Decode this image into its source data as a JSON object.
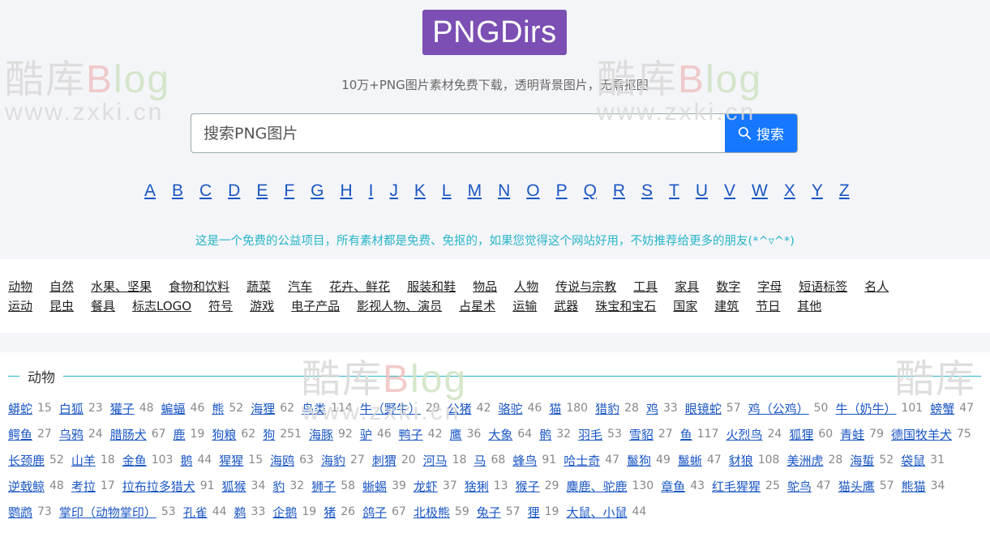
{
  "header": {
    "logo": "PNGDirs",
    "tagline": "10万+PNG图片素材免费下载，透明背景图片，无需抠图"
  },
  "search": {
    "placeholder": "搜索PNG图片",
    "button_label": "搜索"
  },
  "alphabet": [
    "A",
    "B",
    "C",
    "D",
    "E",
    "F",
    "G",
    "H",
    "I",
    "J",
    "K",
    "L",
    "M",
    "N",
    "O",
    "P",
    "Q",
    "R",
    "S",
    "T",
    "U",
    "V",
    "W",
    "X",
    "Y",
    "Z"
  ],
  "notice": "这是一个免费的公益项目，所有素材都是免费、免抠的，如果您觉得这个网站好用，不妨推荐给更多的朋友(*^▿^*)",
  "categories_row1": [
    "动物",
    "自然",
    "水果、坚果",
    "食物和饮料",
    "蔬菜",
    "汽车",
    "花卉、鲜花",
    "服装和鞋",
    "物品",
    "人物",
    "传说与宗教",
    "工具",
    "家具",
    "数字",
    "字母",
    "短语标签",
    "名人"
  ],
  "categories_row2": [
    "运动",
    "昆虫",
    "餐具",
    "标志LOGO",
    "符号",
    "游戏",
    "电子产品",
    "影视人物、演员",
    "占星术",
    "运输",
    "武器",
    "珠宝和宝石",
    "国家",
    "建筑",
    "节日",
    "其他"
  ],
  "section": {
    "title": "动物",
    "items": [
      {
        "name": "蟒蛇",
        "count": "15"
      },
      {
        "name": "白狐",
        "count": "23"
      },
      {
        "name": "獾子",
        "count": "48"
      },
      {
        "name": "蝙蝠",
        "count": "46"
      },
      {
        "name": "熊",
        "count": "52"
      },
      {
        "name": "海狸",
        "count": "62"
      },
      {
        "name": "鸟类",
        "count": "114"
      },
      {
        "name": "牛（野牛）",
        "count": "29"
      },
      {
        "name": "公猪",
        "count": "42"
      },
      {
        "name": "骆驼",
        "count": "46"
      },
      {
        "name": "猫",
        "count": "180"
      },
      {
        "name": "猎豹",
        "count": "28"
      },
      {
        "name": "鸡",
        "count": "33"
      },
      {
        "name": "眼镜蛇",
        "count": "57"
      },
      {
        "name": "鸡（公鸡）",
        "count": "50"
      },
      {
        "name": "牛（奶牛）",
        "count": "101"
      },
      {
        "name": "螃蟹",
        "count": "47"
      },
      {
        "name": "鳄鱼",
        "count": "27"
      },
      {
        "name": "乌鸦",
        "count": "24"
      },
      {
        "name": "腊肠犬",
        "count": "67"
      },
      {
        "name": "鹿",
        "count": "19"
      },
      {
        "name": "狗粮",
        "count": "62"
      },
      {
        "name": "狗",
        "count": "251"
      },
      {
        "name": "海豚",
        "count": "92"
      },
      {
        "name": "驴",
        "count": "46"
      },
      {
        "name": "鸭子",
        "count": "42"
      },
      {
        "name": "鹰",
        "count": "36"
      },
      {
        "name": "大象",
        "count": "64"
      },
      {
        "name": "鹘",
        "count": "32"
      },
      {
        "name": "羽毛",
        "count": "53"
      },
      {
        "name": "雪貂",
        "count": "27"
      },
      {
        "name": "鱼",
        "count": "117"
      },
      {
        "name": "火烈鸟",
        "count": "24"
      },
      {
        "name": "狐狸",
        "count": "60"
      },
      {
        "name": "青蛙",
        "count": "79"
      },
      {
        "name": "德国牧羊犬",
        "count": "75"
      },
      {
        "name": "长颈鹿",
        "count": "52"
      },
      {
        "name": "山羊",
        "count": "18"
      },
      {
        "name": "金鱼",
        "count": "103"
      },
      {
        "name": "鹅",
        "count": "44"
      },
      {
        "name": "猩猩",
        "count": "15"
      },
      {
        "name": "海鸥",
        "count": "63"
      },
      {
        "name": "海豹",
        "count": "27"
      },
      {
        "name": "刺猬",
        "count": "20"
      },
      {
        "name": "河马",
        "count": "18"
      },
      {
        "name": "马",
        "count": "68"
      },
      {
        "name": "蜂鸟",
        "count": "91"
      },
      {
        "name": "哈士奇",
        "count": "47"
      },
      {
        "name": "鬣狗",
        "count": "49"
      },
      {
        "name": "鬣蜥",
        "count": "47"
      },
      {
        "name": "豺狼",
        "count": "108"
      },
      {
        "name": "美洲虎",
        "count": "28"
      },
      {
        "name": "海蜇",
        "count": "52"
      },
      {
        "name": "袋鼠",
        "count": "31"
      },
      {
        "name": "逆戟鲸",
        "count": "48"
      },
      {
        "name": "考拉",
        "count": "17"
      },
      {
        "name": "拉布拉多猎犬",
        "count": "91"
      },
      {
        "name": "狐猴",
        "count": "34"
      },
      {
        "name": "豹",
        "count": "32"
      },
      {
        "name": "狮子",
        "count": "58"
      },
      {
        "name": "蜥蜴",
        "count": "39"
      },
      {
        "name": "龙虾",
        "count": "37"
      },
      {
        "name": "猞猁",
        "count": "13"
      },
      {
        "name": "猴子",
        "count": "29"
      },
      {
        "name": "麋鹿、驼鹿",
        "count": "130"
      },
      {
        "name": "章鱼",
        "count": "43"
      },
      {
        "name": "红毛猩猩",
        "count": "25"
      },
      {
        "name": "鸵鸟",
        "count": "47"
      },
      {
        "name": "猫头鹰",
        "count": "57"
      },
      {
        "name": "熊猫",
        "count": "34"
      },
      {
        "name": "鹦鹉",
        "count": "73"
      },
      {
        "name": "掌印（动物掌印）",
        "count": "53"
      },
      {
        "name": "孔雀",
        "count": "44"
      },
      {
        "name": "鹈",
        "count": "33"
      },
      {
        "name": "企鹅",
        "count": "19"
      },
      {
        "name": "猪",
        "count": "26"
      },
      {
        "name": "鸽子",
        "count": "67"
      },
      {
        "name": "北极熊",
        "count": "59"
      },
      {
        "name": "兔子",
        "count": "57"
      },
      {
        "name": "狸",
        "count": "19"
      },
      {
        "name": "大鼠、小鼠",
        "count": "44"
      }
    ]
  },
  "watermark": {
    "brand_a": "酷库",
    "brand_b": "B",
    "brand_c": "log",
    "url": "www.zxki.cn"
  }
}
